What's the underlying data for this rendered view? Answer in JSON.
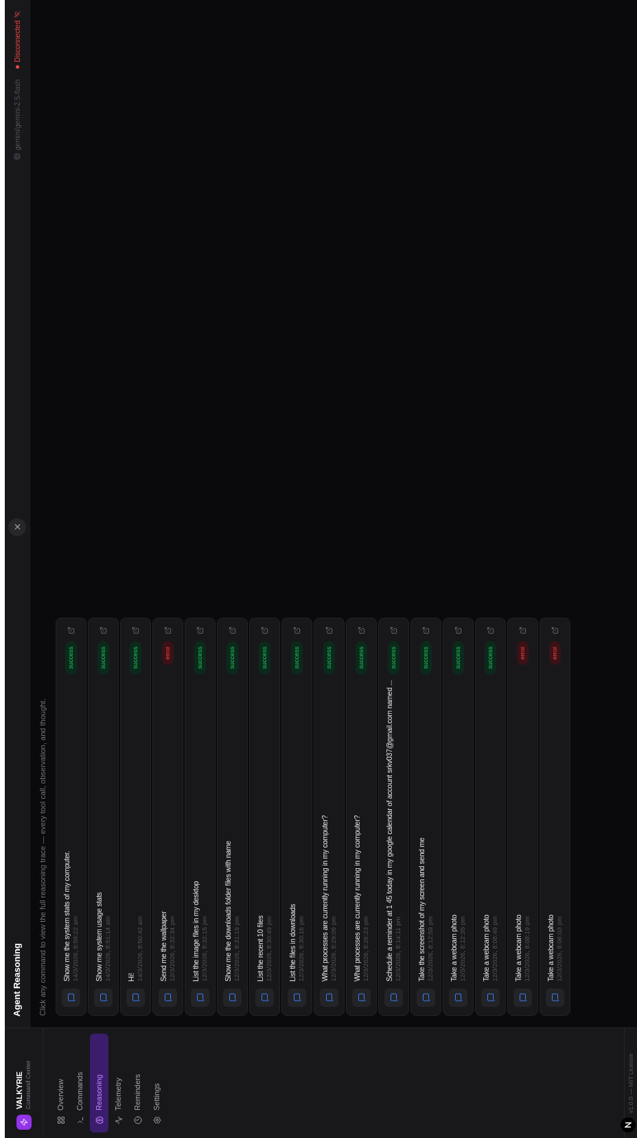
{
  "sidebar": {
    "brand": {
      "name": "VALKYRIE",
      "subtitle": "Command Center"
    },
    "items": [
      {
        "label": "Overview",
        "selected": false
      },
      {
        "label": "Commands",
        "selected": false
      },
      {
        "label": "Reasoning",
        "selected": true
      },
      {
        "label": "Telemetry",
        "selected": false
      },
      {
        "label": "Reminders",
        "selected": false
      },
      {
        "label": "Settings",
        "selected": false
      }
    ],
    "footer": "v1.0.0 — MIT License"
  },
  "header": {
    "title": "Agent Reasoning",
    "model": "gemini/gemini-2.5-flash",
    "connection": {
      "label": "Disconnected",
      "connected": false
    }
  },
  "subtitle": "Click any command to view the full reasoning trace — every tool call, observation, and thought.",
  "commands": [
    {
      "text": "Show me the system stats of my computer.",
      "time": "14/3/2026, 8:59:22 am",
      "status": "success"
    },
    {
      "text": "Show me system usage stats",
      "time": "14/3/2026, 8:51:14 am",
      "status": "success"
    },
    {
      "text": "Hi!",
      "time": "14/3/2026, 8:50:42 am",
      "status": "success"
    },
    {
      "text": "Send me the wallpaper",
      "time": "12/3/2026, 8:32:34 pm",
      "status": "error"
    },
    {
      "text": "List the image files in my desktop",
      "time": "12/3/2026, 8:32:15 pm",
      "status": "success"
    },
    {
      "text": "Show me the downloads folder files with name",
      "time": "12/3/2026, 8:31:19 pm",
      "status": "success"
    },
    {
      "text": "List the recent 10 files",
      "time": "12/3/2026, 8:30:49 pm",
      "status": "success"
    },
    {
      "text": "List the files in downloads",
      "time": "12/3/2026, 8:30:16 pm",
      "status": "success"
    },
    {
      "text": "What processes are currently running in my computer?",
      "time": "12/3/2026, 8:29:09 pm",
      "status": "success"
    },
    {
      "text": "What processes are currently running in my computer?",
      "time": "12/3/2026, 8:26:23 pm",
      "status": "success"
    },
    {
      "text": "Schedule a reminder at 1 45 today in my google calendar of account srkv037@gmail.com named ...",
      "time": "12/3/2026, 8:14:11 pm",
      "status": "success"
    },
    {
      "text": "Take the screenshot of my screen and send me",
      "time": "12/3/2026, 8:12:59 pm",
      "status": "success"
    },
    {
      "text": "Take a webcam photo",
      "time": "12/3/2026, 8:12:35 pm",
      "status": "success"
    },
    {
      "text": "Take a webcam photo",
      "time": "12/3/2026, 8:08:49 pm",
      "status": "success"
    },
    {
      "text": "Take a webcam photo",
      "time": "12/3/2026, 8:08:19 pm",
      "status": "error"
    },
    {
      "text": "Take a webcam photo",
      "time": "12/3/2026, 8:06:03 pm",
      "status": "error"
    }
  ]
}
